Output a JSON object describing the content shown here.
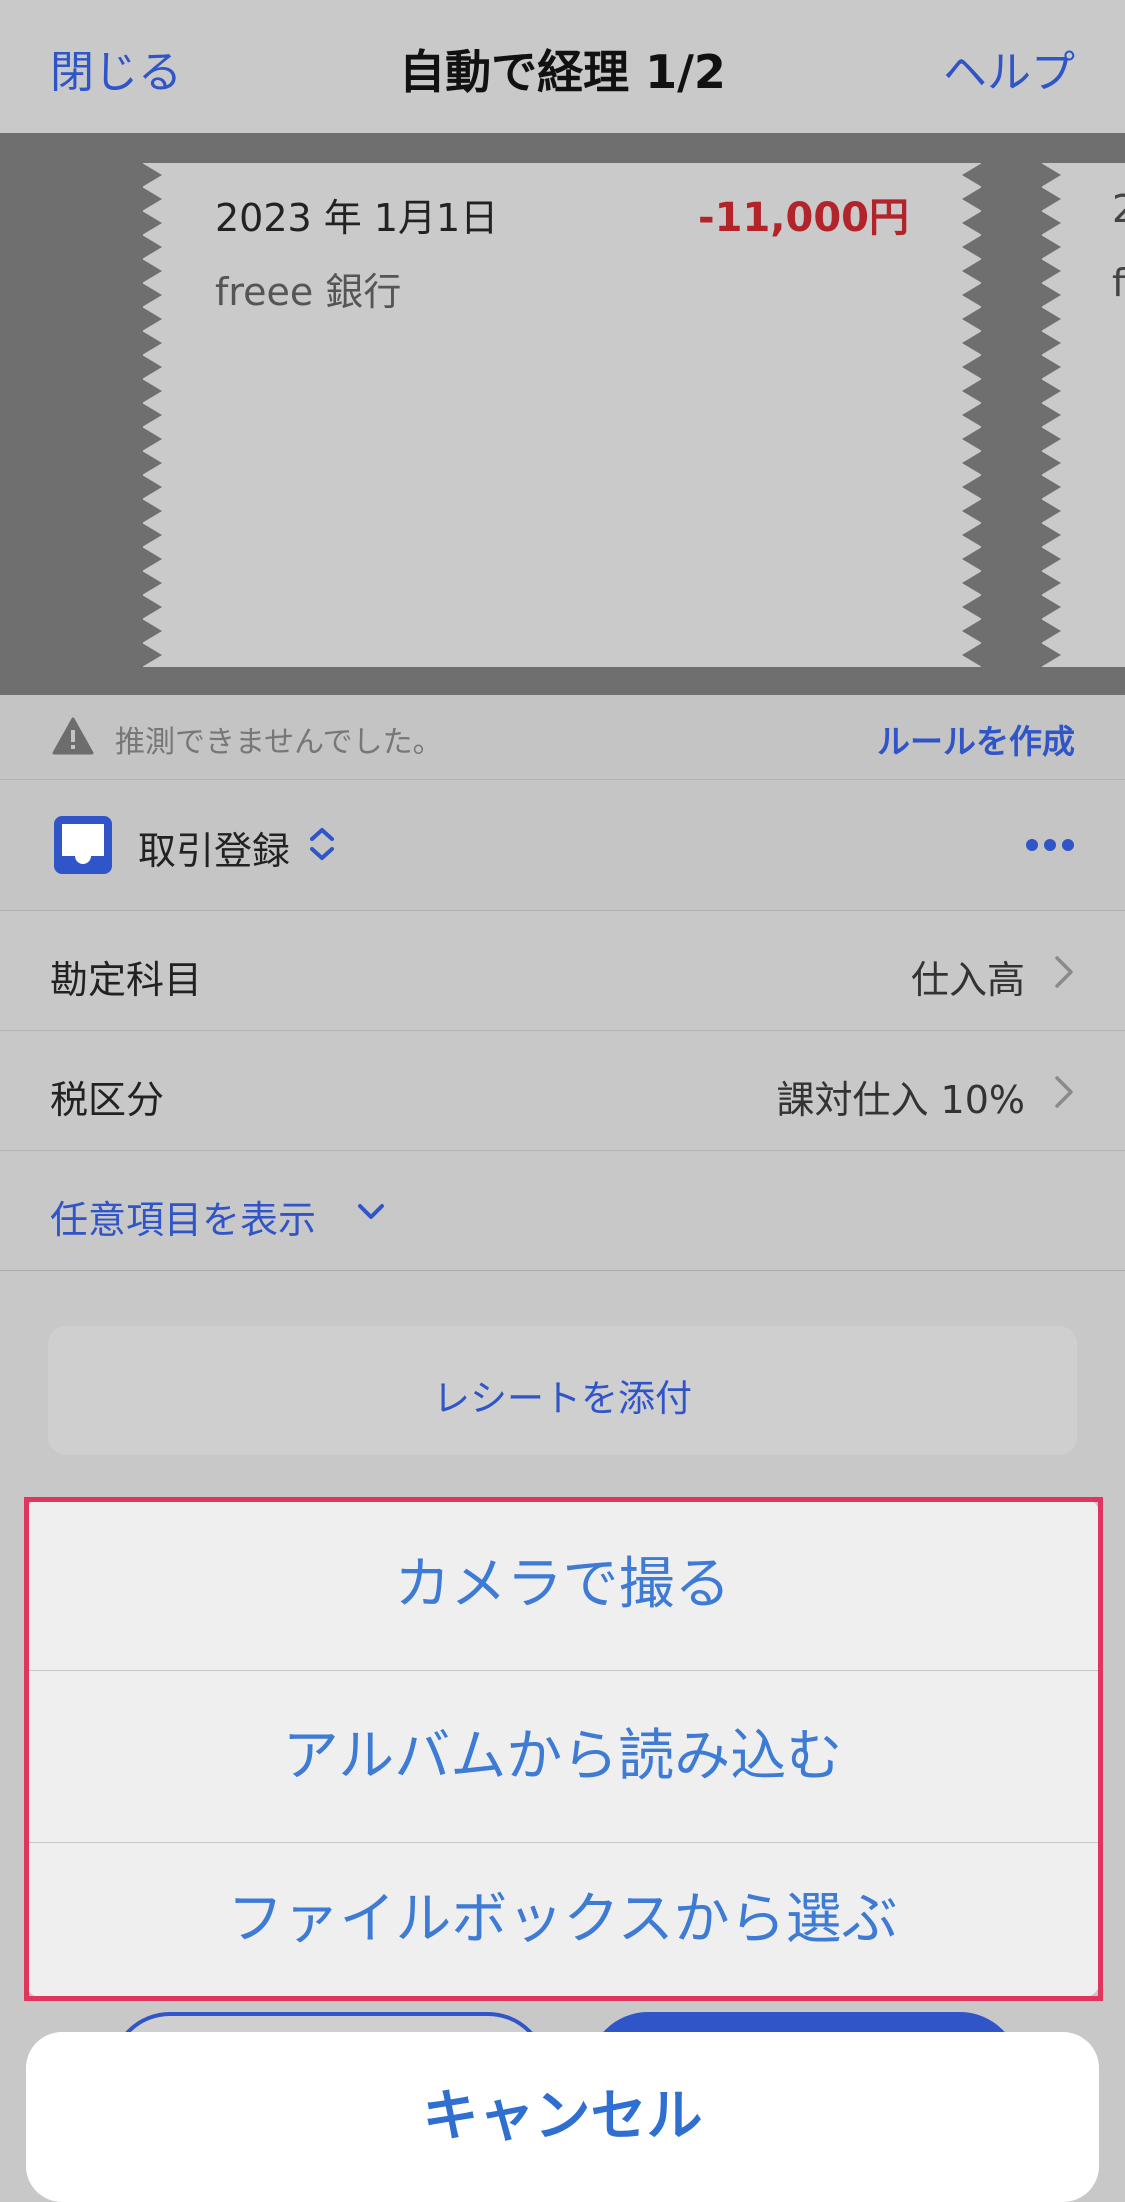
{
  "header": {
    "close_label": "閉じる",
    "title": "自動で経理 1/2",
    "help_label": "ヘルプ"
  },
  "receipt": {
    "date": "2023 年 1月1日",
    "amount": "-11,000円",
    "bank": "freee 銀行",
    "next_date_peek": "2",
    "next_bank_peek": "f"
  },
  "warning": {
    "icon": "warning-triangle-icon",
    "text": "推測できませんでした。",
    "rule_link": "ルールを作成"
  },
  "transaction_type": {
    "icon": "inbox-icon",
    "label": "取引登録",
    "more_icon": "more-dots-icon"
  },
  "fields": [
    {
      "label": "勘定科目",
      "value": "仕入高"
    },
    {
      "label": "税区分",
      "value": "課対仕入 10%"
    }
  ],
  "optional": {
    "label": "任意項目を表示"
  },
  "attach": {
    "label": "レシートを添付"
  },
  "action_sheet": {
    "items": [
      "カメラで撮る",
      "アルバムから読み込む",
      "ファイルボックスから選ぶ"
    ],
    "cancel_label": "キャンセル"
  },
  "colors": {
    "accent": "#2f55c8",
    "amount_negative": "#b3232a",
    "highlight": "#e0365e",
    "sheet_text": "#3e7bd4"
  }
}
